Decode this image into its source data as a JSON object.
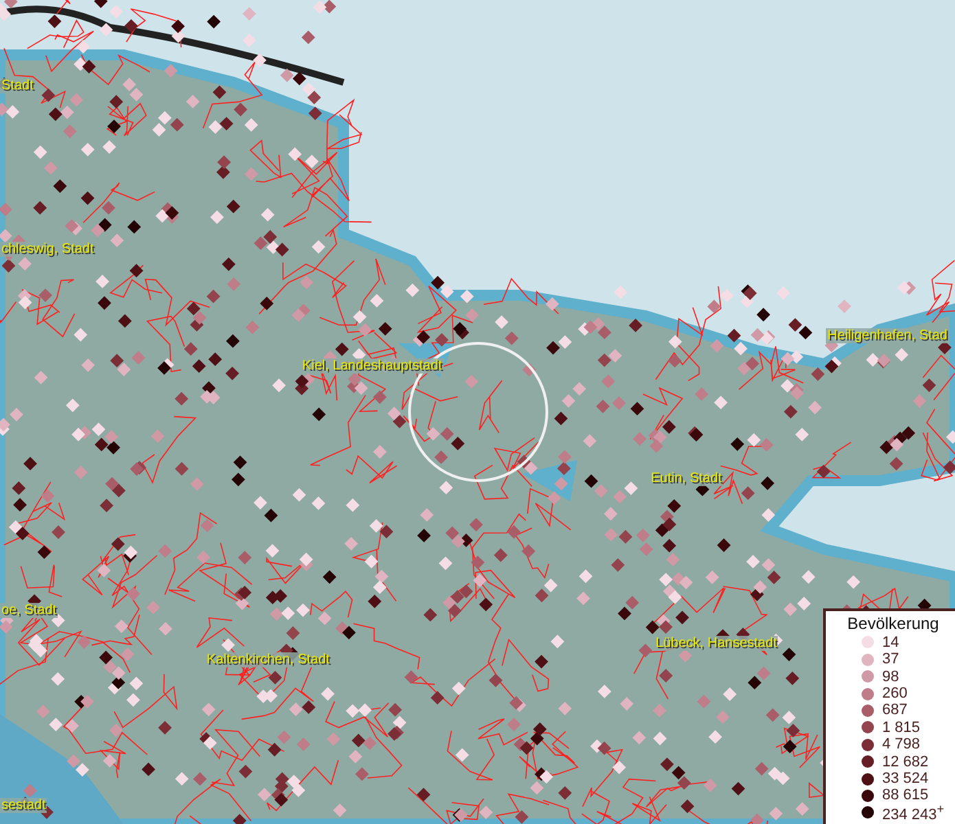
{
  "map": {
    "labels": [
      {
        "text": "Stadt"
      },
      {
        "text": "chleswig, Stadt"
      },
      {
        "text": "Kiel, Landeshauptstadt"
      },
      {
        "text": "Heiligenhafen, Stad"
      },
      {
        "text": "Eutin, Stadt"
      },
      {
        "text": "oe, Stadt"
      },
      {
        "text": "Kaltenkirchen, Stadt"
      },
      {
        "text": "Lübeck, Hansestadt"
      },
      {
        "text": "sestadt"
      }
    ]
  },
  "legend": {
    "title": "Bevölkerung",
    "items": [
      {
        "label": "14",
        "color": "#f5dde6"
      },
      {
        "label": "37",
        "color": "#e0b4c0"
      },
      {
        "label": "98",
        "color": "#cf9aa5"
      },
      {
        "label": "260",
        "color": "#be7d88"
      },
      {
        "label": "687",
        "color": "#a95d68"
      },
      {
        "label": "1 815",
        "color": "#93444d"
      },
      {
        "label": "4 798",
        "color": "#7c2e36"
      },
      {
        "label": "12 682",
        "color": "#661d24"
      },
      {
        "label": "33 524",
        "color": "#4f1015"
      },
      {
        "label": "88 615",
        "color": "#3a070b"
      },
      {
        "label": "234 243$^{+}$",
        "color": "#240305"
      }
    ]
  }
}
